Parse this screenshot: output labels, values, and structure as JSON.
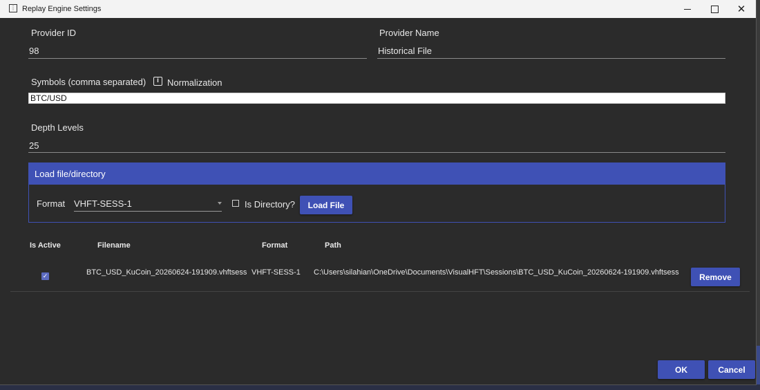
{
  "window": {
    "title": "Replay Engine Settings"
  },
  "provider": {
    "id_label": "Provider ID",
    "id_value": "98",
    "name_label": "Provider Name",
    "name_value": "Historical File"
  },
  "symbols": {
    "label": "Symbols (comma separated)",
    "info_icon_glyph": "i",
    "normalization_label": "Normalization",
    "value": "BTC/USD"
  },
  "depth": {
    "label": "Depth Levels",
    "value": "25"
  },
  "load": {
    "header": "Load file/directory",
    "format_label": "Format",
    "format_selected": "VHFT-SESS-1",
    "is_directory_label": "Is Directory?",
    "is_directory_checked": false,
    "load_button": "Load File"
  },
  "table": {
    "headers": [
      "Is Active",
      "Filename",
      "Format",
      "Path"
    ],
    "rows": [
      {
        "is_active": true,
        "filename": "BTC_USD_KuCoin_20260624-191909.vhftsess",
        "format": "VHFT-SESS-1",
        "path": "C:\\Users\\silahian\\OneDrive\\Documents\\VisualHFT\\Sessions\\BTC_USD_KuCoin_20260624-191909.vhftsess",
        "remove_button": "Remove"
      }
    ]
  },
  "footer": {
    "ok_label": "OK",
    "cancel_label": "Cancel"
  },
  "icons": {
    "minimize": "minimize-icon",
    "maximize": "maximize-icon",
    "close": "close-icon",
    "check_glyph": "✓",
    "close_glyph": "✕"
  },
  "colors": {
    "accent": "#3f51b5",
    "background": "#2b2b2b"
  }
}
